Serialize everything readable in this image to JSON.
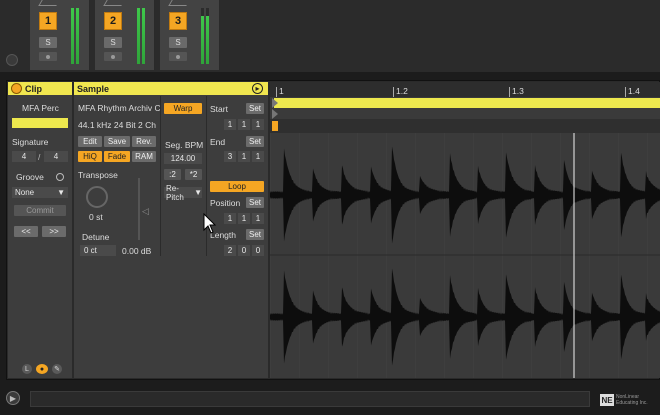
{
  "tracks": [
    {
      "number": "1",
      "solo": "S"
    },
    {
      "number": "2",
      "solo": "S"
    },
    {
      "number": "3",
      "solo": "S"
    }
  ],
  "clip": {
    "title": "Clip",
    "name": "MFA Perc",
    "signature_label": "Signature",
    "sig_num": "4",
    "sig_den": "4",
    "groove_label": "Groove",
    "groove_value": "None",
    "commit": "Commit",
    "nudge_left": "<<",
    "nudge_right": ">>",
    "bottom_icons": [
      "L",
      "●",
      "✎"
    ]
  },
  "sample": {
    "title": "Sample",
    "filename": "MFA Rhythm Archiv C",
    "format": "44.1 kHz 24 Bit 2 Ch",
    "edit": "Edit",
    "save": "Save",
    "rev": "Rev.",
    "hiq": "HiQ",
    "fade": "Fade",
    "ram": "RAM",
    "transpose_label": "Transpose",
    "transpose_value": "0 st",
    "detune_label": "Detune",
    "detune_value": "0 ct",
    "gain_value": "0.00 dB",
    "warp": "Warp",
    "seg_bpm_label": "Seg. BPM",
    "seg_bpm": "124.00",
    "half": ":2",
    "double": "*2",
    "warp_mode": "Re-Pitch",
    "start_label": "Start",
    "start_set": "Set",
    "start": [
      "1",
      "1",
      "1"
    ],
    "end_label": "End",
    "end_set": "Set",
    "end": [
      "3",
      "1",
      "1"
    ],
    "loop": "Loop",
    "position_label": "Position",
    "position_set": "Set",
    "position": [
      "1",
      "1",
      "1"
    ],
    "length_label": "Length",
    "length_set": "Set",
    "length": [
      "2",
      "0",
      "0"
    ]
  },
  "ruler": {
    "ticks": [
      "1",
      "1.2",
      "1.3",
      "1.4"
    ]
  },
  "logo": "NE",
  "logo_text": "NonLinear Educating Inc."
}
